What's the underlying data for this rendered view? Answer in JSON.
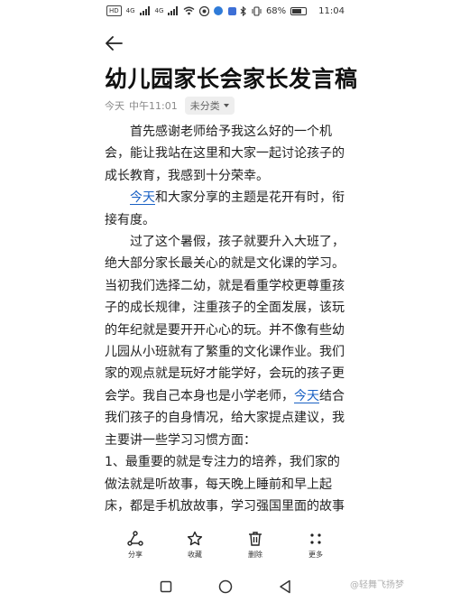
{
  "status": {
    "network_badge": "HD",
    "signal_text": "4G",
    "signal_text_2": "4G",
    "battery_percent": "68%",
    "battery_level": 0.68,
    "time": "11:04"
  },
  "note": {
    "title": "幼儿园家长会家长发言稿",
    "date": "今天",
    "time": "中午11:01",
    "category": "未分类",
    "paragraphs": [
      {
        "indent": true,
        "parts": [
          {
            "text": "首先感谢老师给予我这么好的一个机会，能让我站在这里和大家一起讨论孩子的成长教育，我感到十分荣幸。",
            "link": false
          }
        ]
      },
      {
        "indent": true,
        "parts": [
          {
            "text": "今天",
            "link": true
          },
          {
            "text": "和大家分享的主题是花开有时，衔接有度。",
            "link": false
          }
        ]
      },
      {
        "indent": true,
        "parts": [
          {
            "text": "过了这个暑假，孩子就要升入大班了，绝大部分家长最关心的就是文化课的学习。当初我们选择二幼，就是看重学校更尊重孩子的成长规律，注重孩子的全面发展，该玩的年纪就是要开开心心的玩。并不像有些幼儿园从小班就有了繁重的文化课作业。我们家的观点就是玩好才能学好，会玩的孩子更会学。我自己本身也是小学老师，",
            "link": false
          },
          {
            "text": "今天",
            "link": true
          },
          {
            "text": "结合我们孩子的自身情况，给大家提点建议，我主要讲一些学习习惯方面：",
            "link": false
          }
        ]
      },
      {
        "indent": false,
        "parts": [
          {
            "text": "1、最重要的就是专注力的培养，我们家的做法就是听故事，每天晚上睡前和早上起床，都是手机放故事，学习强国里面的故事",
            "link": false
          }
        ]
      }
    ]
  },
  "toolbar": {
    "share": "分享",
    "favorite": "收藏",
    "delete": "删除",
    "more": "更多"
  },
  "watermark": "@轻舞飞扬梦"
}
